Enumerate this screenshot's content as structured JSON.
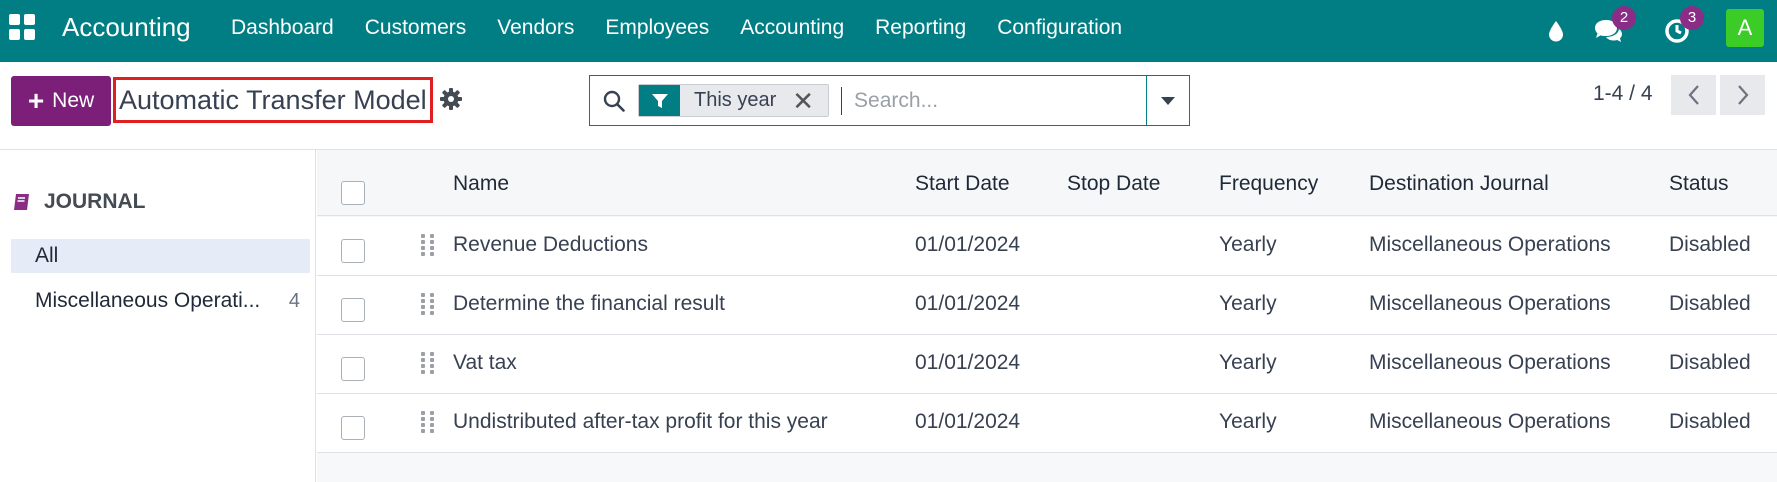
{
  "navbar": {
    "brand": "Accounting",
    "menu": [
      "Dashboard",
      "Customers",
      "Vendors",
      "Employees",
      "Accounting",
      "Reporting",
      "Configuration"
    ],
    "messages_count": "2",
    "activities_count": "3",
    "avatar_letter": "A",
    "accent_color": "#017e84"
  },
  "control_panel": {
    "new_label": "New",
    "page_title": "Automatic Transfer Model",
    "facet_label": "This year",
    "search_placeholder": "Search...",
    "pager": "1-4 / 4"
  },
  "sidebar": {
    "header": "JOURNAL",
    "items": [
      {
        "label": "All",
        "count": ""
      },
      {
        "label": "Miscellaneous Operati...",
        "count": "4"
      }
    ]
  },
  "table": {
    "columns": [
      "Name",
      "Start Date",
      "Stop Date",
      "Frequency",
      "Destination Journal",
      "Status"
    ],
    "rows": [
      {
        "name": "Revenue Deductions",
        "start_date": "01/01/2024",
        "stop_date": "",
        "frequency": "Yearly",
        "journal": "Miscellaneous Operations",
        "status": "Disabled"
      },
      {
        "name": "Determine the financial result",
        "start_date": "01/01/2024",
        "stop_date": "",
        "frequency": "Yearly",
        "journal": "Miscellaneous Operations",
        "status": "Disabled"
      },
      {
        "name": "Vat tax",
        "start_date": "01/01/2024",
        "stop_date": "",
        "frequency": "Yearly",
        "journal": "Miscellaneous Operations",
        "status": "Disabled"
      },
      {
        "name": "Undistributed after-tax profit for this year",
        "start_date": "01/01/2024",
        "stop_date": "",
        "frequency": "Yearly",
        "journal": "Miscellaneous Operations",
        "status": "Disabled"
      }
    ]
  }
}
